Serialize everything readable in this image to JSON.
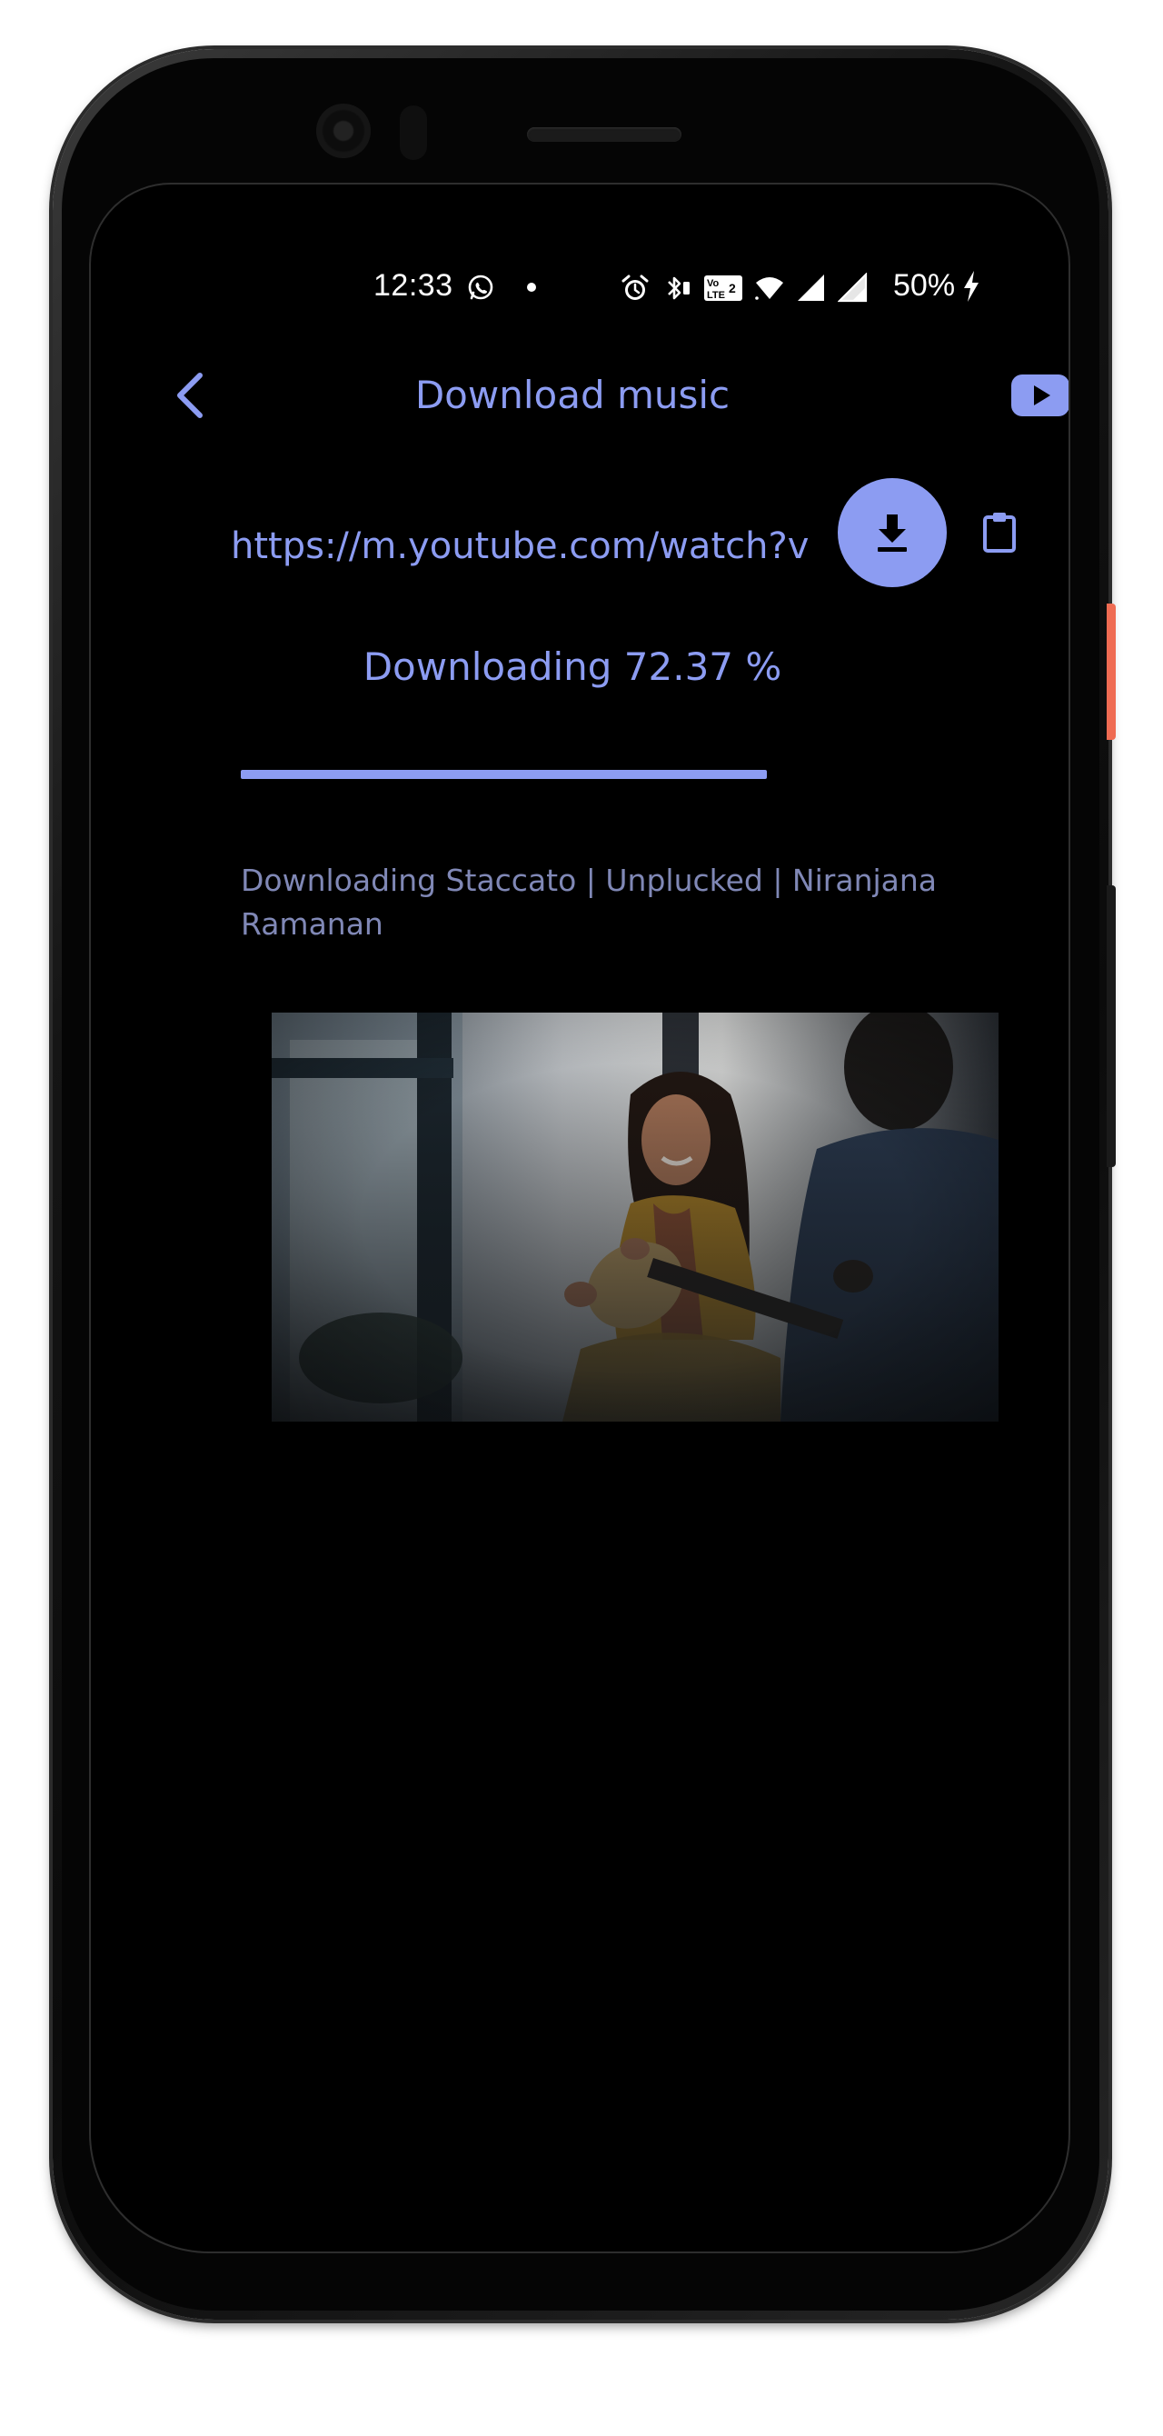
{
  "status_bar": {
    "time": "12:33",
    "battery": "50%",
    "icons": [
      "whatsapp-icon",
      "notification-dot",
      "alarm-icon",
      "bluetooth-icon",
      "volte-icon",
      "wifi-icon",
      "signal-icon",
      "signal-icon",
      "charging-bolt-icon"
    ]
  },
  "app_bar": {
    "title": "Download music",
    "back_icon": "chevron-left-icon",
    "youtube_icon": "youtube-icon"
  },
  "url_field": {
    "value": "https://m.youtube.com/watch?v",
    "download_icon": "download-icon",
    "paste_icon": "clipboard-icon"
  },
  "progress": {
    "label": "Downloading 72.37 %",
    "percent": 72.37
  },
  "current_download": {
    "label": "Downloading Staccato | Unplucked  | Niranjana Ramanan"
  },
  "thumbnail": {
    "description_icon": "video-thumbnail"
  },
  "colors": {
    "accent": "#8c9cf2",
    "subtext": "#8088b6",
    "background": "#000000"
  }
}
